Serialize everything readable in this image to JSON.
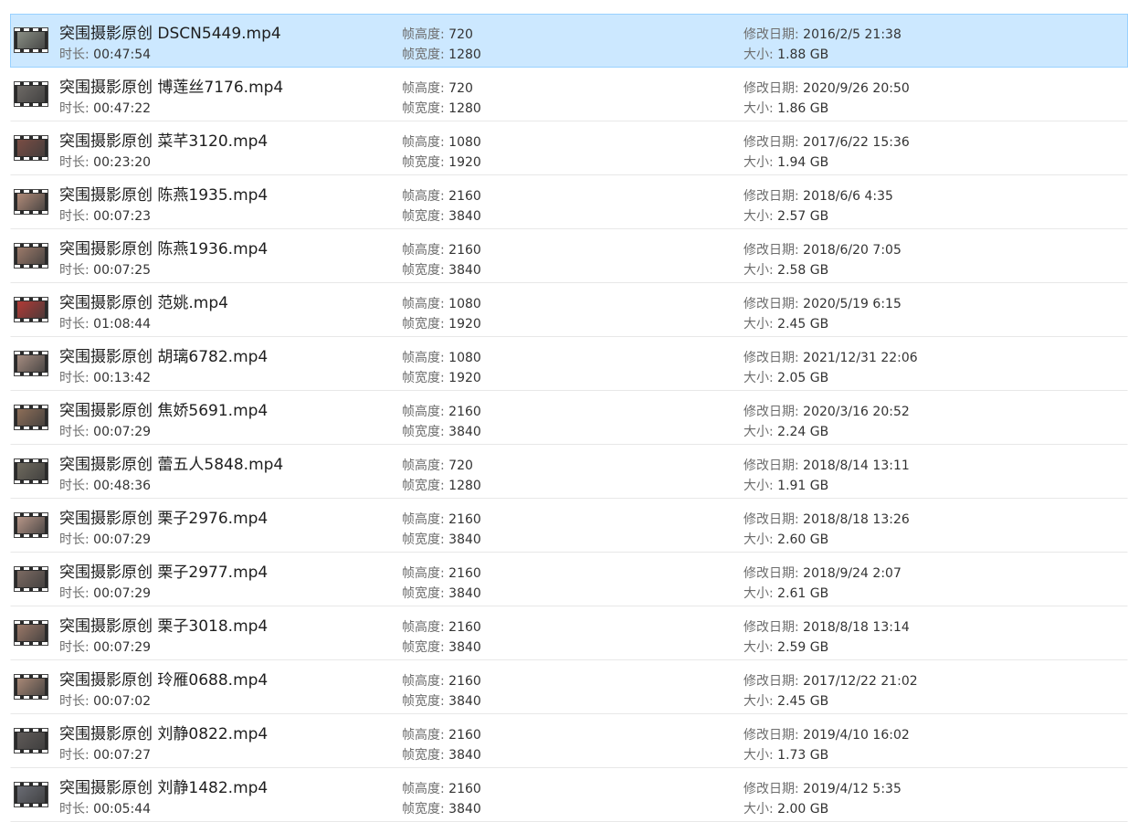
{
  "labels": {
    "duration": "时长: ",
    "frame_height": "帧高度: ",
    "frame_width": "帧宽度: ",
    "modified": "修改日期: ",
    "size": "大小: "
  },
  "files": [
    {
      "name": "突围摄影原创 DSCN5449.mp4",
      "duration": "00:47:54",
      "frame_height": "720",
      "frame_width": "1280",
      "modified": "2016/2/5 21:38",
      "size": "1.88 GB",
      "selected": true,
      "thumb_color": "#8a8f85"
    },
    {
      "name": "突围摄影原创 博莲丝7176.mp4",
      "duration": "00:47:22",
      "frame_height": "720",
      "frame_width": "1280",
      "modified": "2020/9/26 20:50",
      "size": "1.86 GB",
      "selected": false,
      "thumb_color": "#6e6a66"
    },
    {
      "name": "突围摄影原创 菜芊3120.mp4",
      "duration": "00:23:20",
      "frame_height": "1080",
      "frame_width": "1920",
      "modified": "2017/6/22 15:36",
      "size": "1.94 GB",
      "selected": false,
      "thumb_color": "#7a4d44"
    },
    {
      "name": "突围摄影原创 陈燕1935.mp4",
      "duration": "00:07:23",
      "frame_height": "2160",
      "frame_width": "3840",
      "modified": "2018/6/6 4:35",
      "size": "2.57 GB",
      "selected": false,
      "thumb_color": "#b08a78"
    },
    {
      "name": "突围摄影原创 陈燕1936.mp4",
      "duration": "00:07:25",
      "frame_height": "2160",
      "frame_width": "3840",
      "modified": "2018/6/20 7:05",
      "size": "2.58 GB",
      "selected": false,
      "thumb_color": "#9c7a6a"
    },
    {
      "name": "突围摄影原创 范姚.mp4",
      "duration": "01:08:44",
      "frame_height": "1080",
      "frame_width": "1920",
      "modified": "2020/5/19 6:15",
      "size": "2.45 GB",
      "selected": false,
      "thumb_color": "#b33a36"
    },
    {
      "name": "突围摄影原创 胡璃6782.mp4",
      "duration": "00:13:42",
      "frame_height": "1080",
      "frame_width": "1920",
      "modified": "2021/12/31 22:06",
      "size": "2.05 GB",
      "selected": false,
      "thumb_color": "#a58c80"
    },
    {
      "name": "突围摄影原创 焦娇5691.mp4",
      "duration": "00:07:29",
      "frame_height": "2160",
      "frame_width": "3840",
      "modified": "2020/3/16 20:52",
      "size": "2.24 GB",
      "selected": false,
      "thumb_color": "#8d6e58"
    },
    {
      "name": "突围摄影原创 蕾五人5848.mp4",
      "duration": "00:48:36",
      "frame_height": "720",
      "frame_width": "1280",
      "modified": "2018/8/14 13:11",
      "size": "1.91 GB",
      "selected": false,
      "thumb_color": "#6f6a5e"
    },
    {
      "name": "突围摄影原创 栗子2976.mp4",
      "duration": "00:07:29",
      "frame_height": "2160",
      "frame_width": "3840",
      "modified": "2018/8/18 13:26",
      "size": "2.60 GB",
      "selected": false,
      "thumb_color": "#b79688"
    },
    {
      "name": "突围摄影原创 栗子2977.mp4",
      "duration": "00:07:29",
      "frame_height": "2160",
      "frame_width": "3840",
      "modified": "2018/9/24 2:07",
      "size": "2.61 GB",
      "selected": false,
      "thumb_color": "#7c6a62"
    },
    {
      "name": "突围摄影原创 栗子3018.mp4",
      "duration": "00:07:29",
      "frame_height": "2160",
      "frame_width": "3840",
      "modified": "2018/8/18 13:14",
      "size": "2.59 GB",
      "selected": false,
      "thumb_color": "#9a7868"
    },
    {
      "name": "突围摄影原创 玲雁0688.mp4",
      "duration": "00:07:02",
      "frame_height": "2160",
      "frame_width": "3840",
      "modified": "2017/12/22 21:02",
      "size": "2.45 GB",
      "selected": false,
      "thumb_color": "#a88876"
    },
    {
      "name": "突围摄影原创 刘静0822.mp4",
      "duration": "00:07:27",
      "frame_height": "2160",
      "frame_width": "3840",
      "modified": "2019/4/10 16:02",
      "size": "1.73 GB",
      "selected": false,
      "thumb_color": "#5f5a58"
    },
    {
      "name": "突围摄影原创 刘静1482.mp4",
      "duration": "00:05:44",
      "frame_height": "2160",
      "frame_width": "3840",
      "modified": "2019/4/12 5:35",
      "size": "2.00 GB",
      "selected": false,
      "thumb_color": "#6a6c74"
    }
  ]
}
